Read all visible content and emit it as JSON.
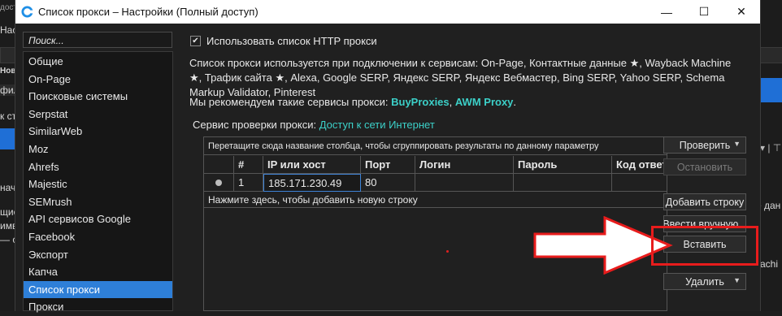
{
  "background": {
    "top_left": "доступ",
    "menu": "Нас",
    "new_label": "Новы",
    "tab_label": "фил",
    "lines": [
      "к ст",
      "нача",
      "щие с",
      "имв",
      "— с"
    ],
    "right_lines": [
      "е дан",
      "achi"
    ]
  },
  "window": {
    "title": "Список прокси – Настройки (Полный доступ)",
    "controls": {
      "minimize": "—",
      "maximize": "☐",
      "close": "✕"
    }
  },
  "search": {
    "placeholder": "Поиск..."
  },
  "sidebar": {
    "items": [
      {
        "label": "Общие"
      },
      {
        "label": "On-Page"
      },
      {
        "label": "Поисковые системы"
      },
      {
        "label": "Serpstat"
      },
      {
        "label": "SimilarWeb"
      },
      {
        "label": "Moz"
      },
      {
        "label": "Ahrefs"
      },
      {
        "label": "Majestic"
      },
      {
        "label": "SEMrush"
      },
      {
        "label": "API сервисов Google"
      },
      {
        "label": "Facebook"
      },
      {
        "label": "Экспорт"
      },
      {
        "label": "Капча"
      },
      {
        "label": "Список прокси",
        "active": true
      },
      {
        "label": "Прокси"
      }
    ]
  },
  "content": {
    "use_proxy_checkbox": {
      "label": "Использовать список HTTP прокси",
      "checked": true
    },
    "description": "Список прокси используется при подключении к сервисам: On-Page, Контактные данные ★, Wayback Machine ★, Трафик сайта ★, Alexa, Google SERP, Яндекс SERP, Яндекс Вебмастер, Bing SERP, Yahoo SERP, Schema Markup Validator, Pinterest",
    "recommend": {
      "prefix": "Мы рекомендуем такие сервисы прокси: ",
      "link1": "BuyProxies",
      "sep": ", ",
      "link2": "AWM Proxy",
      "suffix": "."
    },
    "check_service": {
      "prefix": "Сервис проверки прокси: ",
      "link": "Доступ к сети Интернет"
    }
  },
  "grid": {
    "group_hint": "Перетащите сюда название столбца, чтобы сгруппировать результаты по данному параметру",
    "columns": [
      "",
      "#",
      "IP или хост",
      "Порт",
      "Логин",
      "Пароль",
      "Код ответ"
    ],
    "rows": [
      {
        "num": "1",
        "ip": "185.171.230.49",
        "port": "80",
        "login": "",
        "password": "",
        "code": ""
      }
    ],
    "new_row_hint": "Нажмите здесь, чтобы добавить новую строку"
  },
  "buttons": {
    "check": "Проверить",
    "stop": "Остановить",
    "add_row": "Добавить строку",
    "enter_manual": "Ввести вручную...",
    "paste": "Вставить",
    "delete": "Удалить",
    "caret": "▼"
  },
  "colors": {
    "accent": "#2e7fd8",
    "link": "#3cd0c8",
    "highlight": "#e81c1c"
  }
}
